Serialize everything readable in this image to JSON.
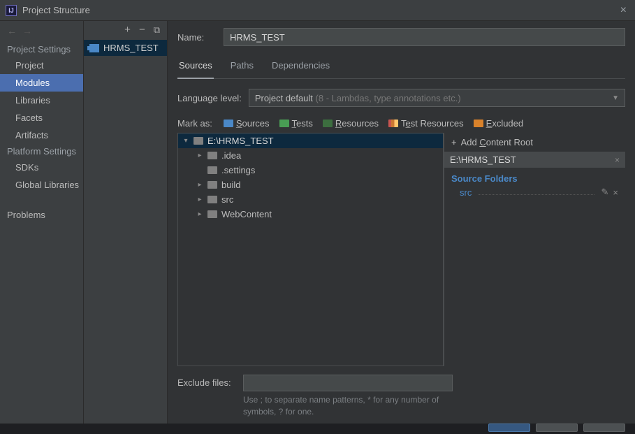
{
  "window": {
    "title": "Project Structure"
  },
  "sidebar": {
    "sections": [
      {
        "title": "Project Settings",
        "items": [
          "Project",
          "Modules",
          "Libraries",
          "Facets",
          "Artifacts"
        ],
        "selected": "Modules"
      },
      {
        "title": "Platform Settings",
        "items": [
          "SDKs",
          "Global Libraries"
        ]
      }
    ],
    "footerItem": "Problems"
  },
  "modules": {
    "selected": "HRMS_TEST"
  },
  "detail": {
    "nameLabel": "Name:",
    "nameValue": "HRMS_TEST",
    "tabs": [
      "Sources",
      "Paths",
      "Dependencies"
    ],
    "activeTab": "Sources",
    "languageLevelLabel": "Language level:",
    "languageLevel": {
      "value": "Project default",
      "hint": " (8 - Lambdas, type annotations etc.)"
    },
    "markAsLabel": "Mark as:",
    "markTypes": {
      "sources": "Sources",
      "tests": "Tests",
      "resources": "Resources",
      "testResources": "Test Resources",
      "excluded": "Excluded"
    },
    "tree": {
      "root": "E:\\HRMS_TEST",
      "children": [
        {
          "name": ".idea",
          "expandable": true
        },
        {
          "name": ".settings",
          "expandable": false
        },
        {
          "name": "build",
          "expandable": true
        },
        {
          "name": "src",
          "expandable": true
        },
        {
          "name": "WebContent",
          "expandable": true
        }
      ]
    },
    "addContentRoot": "Add Content Root",
    "contentRoot": "E:\\HRMS_TEST",
    "sourceFoldersHeading": "Source Folders",
    "sourceFolders": [
      "src"
    ],
    "excludeLabel": "Exclude files:",
    "excludeHint": "Use ; to separate name patterns, * for any number of symbols, ? for one."
  }
}
